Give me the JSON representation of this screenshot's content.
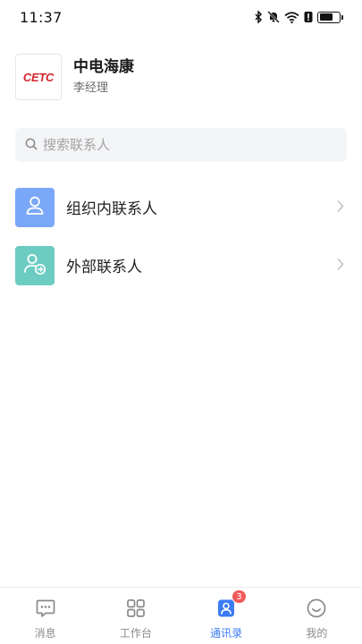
{
  "status_bar": {
    "time": "11:37",
    "icons": [
      "bluetooth-icon",
      "mute-icon",
      "wifi-icon",
      "alert-icon",
      "battery-icon"
    ],
    "battery_level": 0.7
  },
  "org": {
    "logo_text": "CETC",
    "name": "中电海康",
    "user": "李经理",
    "logo_color": "#d3262e"
  },
  "search": {
    "placeholder": "搜索联系人"
  },
  "contacts": [
    {
      "label": "组织内联系人",
      "icon": "user-icon",
      "color": "#7aa7f7"
    },
    {
      "label": "外部联系人",
      "icon": "external-user-icon",
      "color": "#6dccc1"
    }
  ],
  "nav": {
    "tabs": [
      {
        "label": "消息",
        "icon": "message-icon",
        "active": false
      },
      {
        "label": "工作台",
        "icon": "grid-icon",
        "active": false
      },
      {
        "label": "通讯录",
        "icon": "contacts-icon",
        "active": true,
        "badge": "3"
      },
      {
        "label": "我的",
        "icon": "smile-icon",
        "active": false
      }
    ],
    "active_color": "#3b7cf5",
    "badge_color": "#f05b5b"
  }
}
